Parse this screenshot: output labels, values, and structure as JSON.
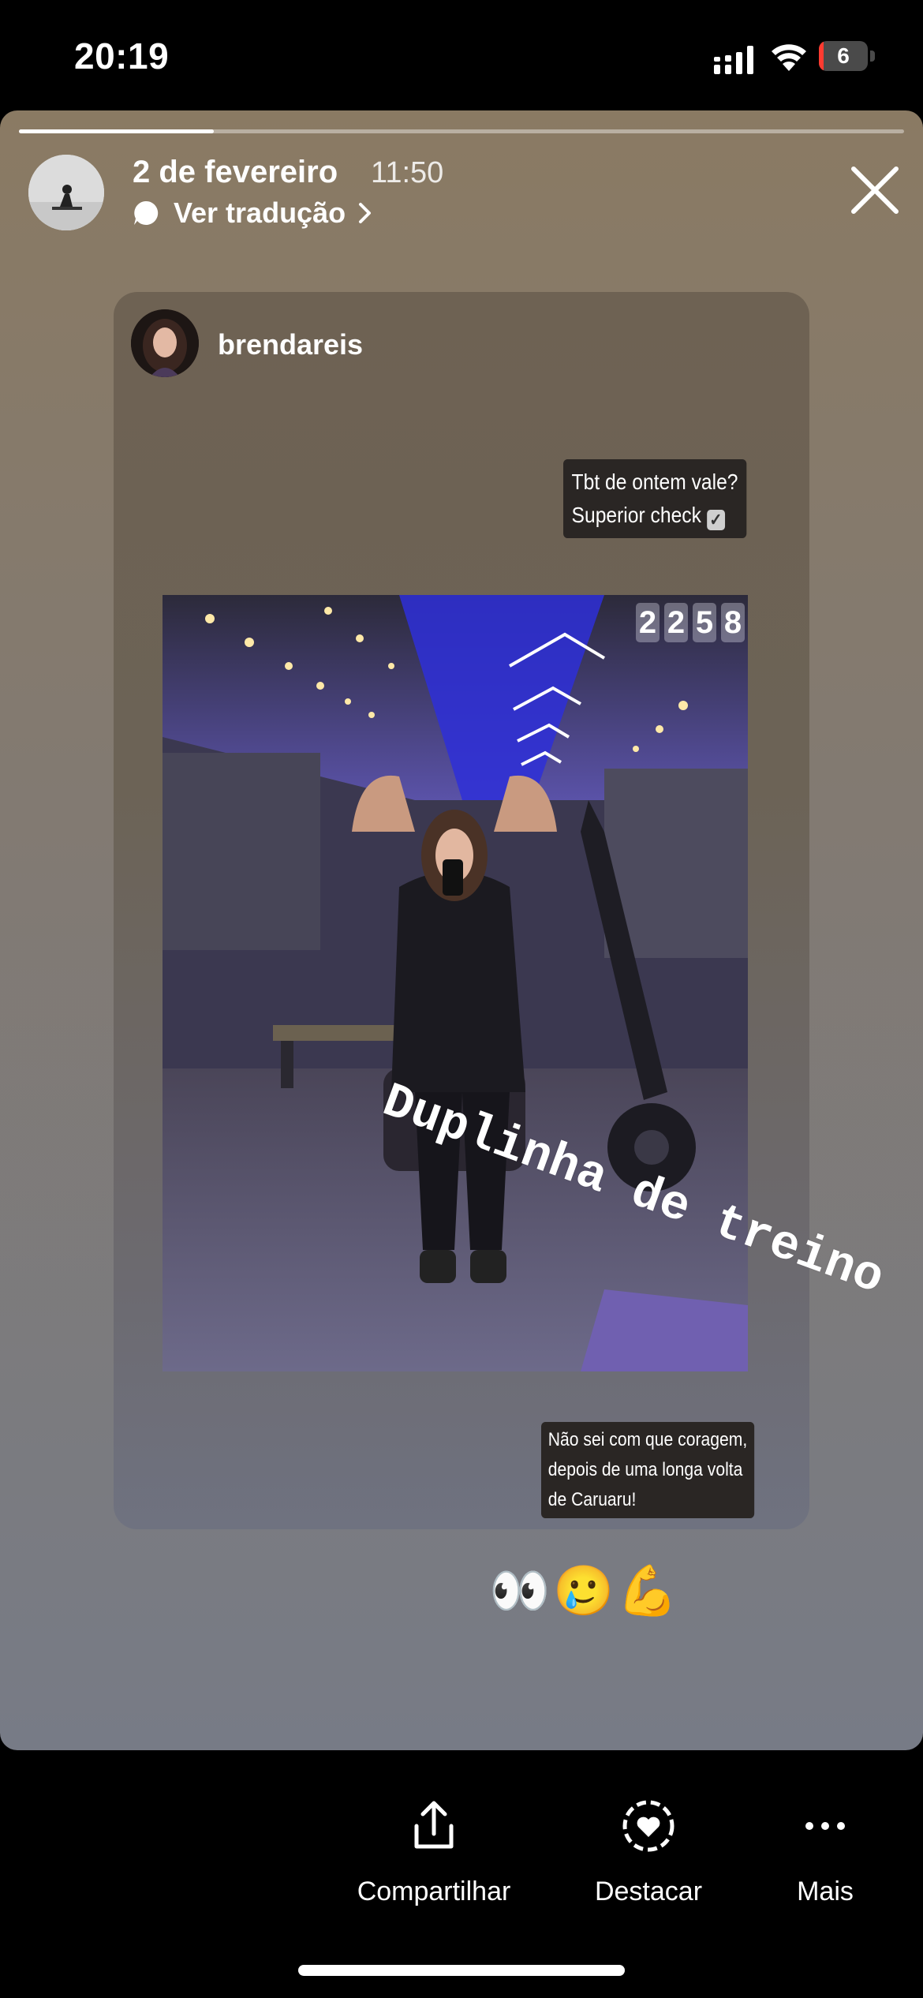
{
  "status_bar": {
    "time": "20:19",
    "battery_level": "6",
    "battery_fraction": 0.06,
    "battery_color": "#ff3b30"
  },
  "story": {
    "progress_fraction": 0.22,
    "date": "2 de fevereiro",
    "time": "11:50",
    "translate_label": "Ver tradução",
    "close_icon": "close-icon",
    "background_colors": [
      "#8a7a63",
      "#777b86"
    ]
  },
  "post": {
    "username": "brendareis",
    "caption_top": [
      "Tbt de ontem vale?",
      "Superior check"
    ],
    "check_glyph": "✓",
    "clock_digits": [
      "2",
      "2",
      "5",
      "8"
    ],
    "caption_bottom": [
      "Não sei com que coragem,",
      "depois de uma longa volta",
      "de Caruaru!"
    ]
  },
  "overlay": {
    "text": "Duplinha de treino",
    "emojis": "👀🥲💪"
  },
  "actions": {
    "share_label": "Compartilhar",
    "highlight_label": "Destacar",
    "more_label": "Mais"
  }
}
